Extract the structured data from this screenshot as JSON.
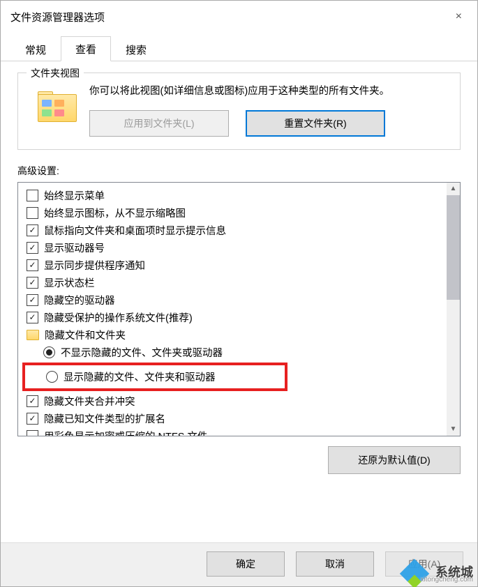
{
  "window": {
    "title": "文件资源管理器选项",
    "close_label": "×"
  },
  "tabs": {
    "general": "常规",
    "view": "查看",
    "search": "搜索"
  },
  "folder_view": {
    "legend": "文件夹视图",
    "desc": "你可以将此视图(如详细信息或图标)应用于这种类型的所有文件夹。",
    "apply_btn": "应用到文件夹(L)",
    "reset_btn": "重置文件夹(R)"
  },
  "advanced": {
    "label": "高级设置:",
    "items": [
      {
        "type": "chk",
        "checked": false,
        "text": "始终显示菜单"
      },
      {
        "type": "chk",
        "checked": false,
        "text": "始终显示图标，从不显示缩略图"
      },
      {
        "type": "chk",
        "checked": true,
        "text": "鼠标指向文件夹和桌面项时显示提示信息"
      },
      {
        "type": "chk",
        "checked": true,
        "text": "显示驱动器号"
      },
      {
        "type": "chk",
        "checked": true,
        "text": "显示同步提供程序通知"
      },
      {
        "type": "chk",
        "checked": true,
        "text": "显示状态栏"
      },
      {
        "type": "chk",
        "checked": true,
        "text": "隐藏空的驱动器"
      },
      {
        "type": "chk",
        "checked": true,
        "text": "隐藏受保护的操作系统文件(推荐)"
      },
      {
        "type": "folder",
        "text": "隐藏文件和文件夹"
      },
      {
        "type": "rad",
        "checked": true,
        "indent": true,
        "text": "不显示隐藏的文件、文件夹或驱动器"
      },
      {
        "type": "rad",
        "checked": false,
        "indent": true,
        "highlight": true,
        "text": "显示隐藏的文件、文件夹和驱动器"
      },
      {
        "type": "chk",
        "checked": true,
        "text": "隐藏文件夹合并冲突"
      },
      {
        "type": "chk",
        "checked": true,
        "text": "隐藏已知文件类型的扩展名"
      },
      {
        "type": "chk",
        "checked": false,
        "text": "用彩色显示加密或压缩的 NTFS 文件"
      }
    ],
    "restore_btn": "还原为默认值(D)"
  },
  "buttons": {
    "ok": "确定",
    "cancel": "取消",
    "apply": "应用(A)"
  },
  "watermark": {
    "brand": "系统城",
    "url": "xitongcheng.com"
  }
}
